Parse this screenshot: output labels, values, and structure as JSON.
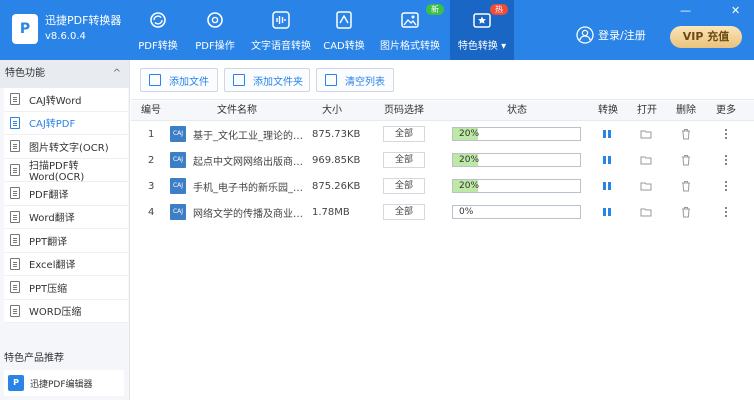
{
  "app": {
    "logo_text": "P",
    "title": "迅捷PDF转换器",
    "version": "v8.6.0.4"
  },
  "nav": [
    {
      "label": "PDF转换",
      "icon": "refresh-icon"
    },
    {
      "label": "PDF操作",
      "icon": "settings-icon"
    },
    {
      "label": "文字语音转换",
      "icon": "voice-wave-icon"
    },
    {
      "label": "CAD转换",
      "icon": "cad-icon"
    },
    {
      "label": "图片格式转换",
      "icon": "image-icon",
      "badge": "新"
    },
    {
      "label": "特色转换 ▾",
      "icon": "star-icon",
      "badge": "热",
      "active": true
    }
  ],
  "window": {
    "minimize": "—",
    "close": "✕"
  },
  "user": {
    "login_label": "登录/注册"
  },
  "vip": {
    "label": "VIP 充值"
  },
  "sidebar": {
    "title": "特色功能",
    "collapse_glyph": "^",
    "items": [
      {
        "label": "CAJ转Word"
      },
      {
        "label": "CAJ转PDF",
        "active": true
      },
      {
        "label": "图片转文字(OCR)"
      },
      {
        "label": "扫描PDF转Word(OCR)"
      },
      {
        "label": "PDF翻译"
      },
      {
        "label": "Word翻译"
      },
      {
        "label": "PPT翻译"
      },
      {
        "label": "Excel翻译"
      },
      {
        "label": "PPT压缩"
      },
      {
        "label": "WORD压缩"
      }
    ],
    "promo_title": "特色产品推荐",
    "promo_item": {
      "label": "迅捷PDF编辑器",
      "logo": "P"
    }
  },
  "toolbar": {
    "add_file": "添加文件",
    "add_folder": "添加文件夹",
    "clear_list": "清空列表"
  },
  "table": {
    "columns": [
      "编号",
      "文件名称",
      "大小",
      "页码选择",
      "状态",
      "转换",
      "打开",
      "删除",
      "更多"
    ],
    "file_icon_text": "CAJ",
    "rows": [
      {
        "num": "1",
        "name": "基于_文化工业_理论的手...",
        "size": "875.73KB",
        "pages": "全部",
        "status": "20%",
        "progress": 0.2
      },
      {
        "num": "2",
        "name": "起点中文网网络出版商业...",
        "size": "969.85KB",
        "pages": "全部",
        "status": "20%",
        "progress": 0.2
      },
      {
        "num": "3",
        "name": "手机_电子书的新乐园_张...",
        "size": "875.26KB",
        "pages": "全部",
        "status": "20%",
        "progress": 0.2
      },
      {
        "num": "4",
        "name": "网络文学的传播及商业化...",
        "size": "1.78MB",
        "pages": "全部",
        "status": "0%",
        "progress": 0
      }
    ]
  },
  "colors": {
    "accent": "#2a84e8",
    "header": "#2a84e8",
    "progress": "#bde8a5"
  }
}
